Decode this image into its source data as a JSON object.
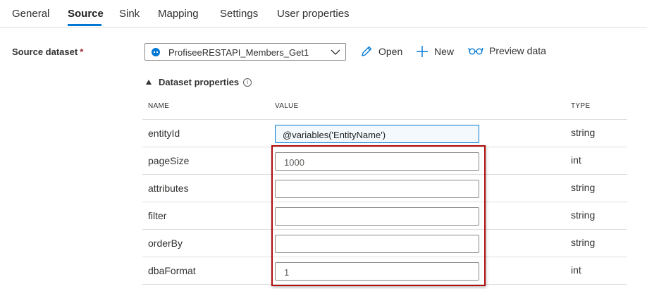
{
  "tabs": [
    {
      "label": "General",
      "active": false
    },
    {
      "label": "Source",
      "active": true
    },
    {
      "label": "Sink",
      "active": false
    },
    {
      "label": "Mapping",
      "active": false
    },
    {
      "label": "Settings",
      "active": false
    },
    {
      "label": "User properties",
      "active": false
    }
  ],
  "source": {
    "label": "Source dataset",
    "required_marker": "*",
    "dataset_value": "ProfiseeRESTAPI_Members_Get1"
  },
  "actions": {
    "open": "Open",
    "new": "New",
    "preview": "Preview data"
  },
  "dataset_properties": {
    "title": "Dataset properties",
    "info_glyph": "i",
    "columns": {
      "name": "NAME",
      "value": "VALUE",
      "type": "TYPE"
    },
    "rows": [
      {
        "name": "entityId",
        "value": "@variables('EntityName')",
        "type": "string"
      },
      {
        "name": "pageSize",
        "value": "1000",
        "type": "int"
      },
      {
        "name": "attributes",
        "value": "",
        "type": "string"
      },
      {
        "name": "filter",
        "value": "",
        "type": "string"
      },
      {
        "name": "orderBy",
        "value": "",
        "type": "string"
      },
      {
        "name": "dbaFormat",
        "value": "1",
        "type": "int"
      }
    ]
  },
  "colors": {
    "accent": "#0078d4",
    "highlight": "#b00d0d",
    "required": "#a4262c"
  }
}
